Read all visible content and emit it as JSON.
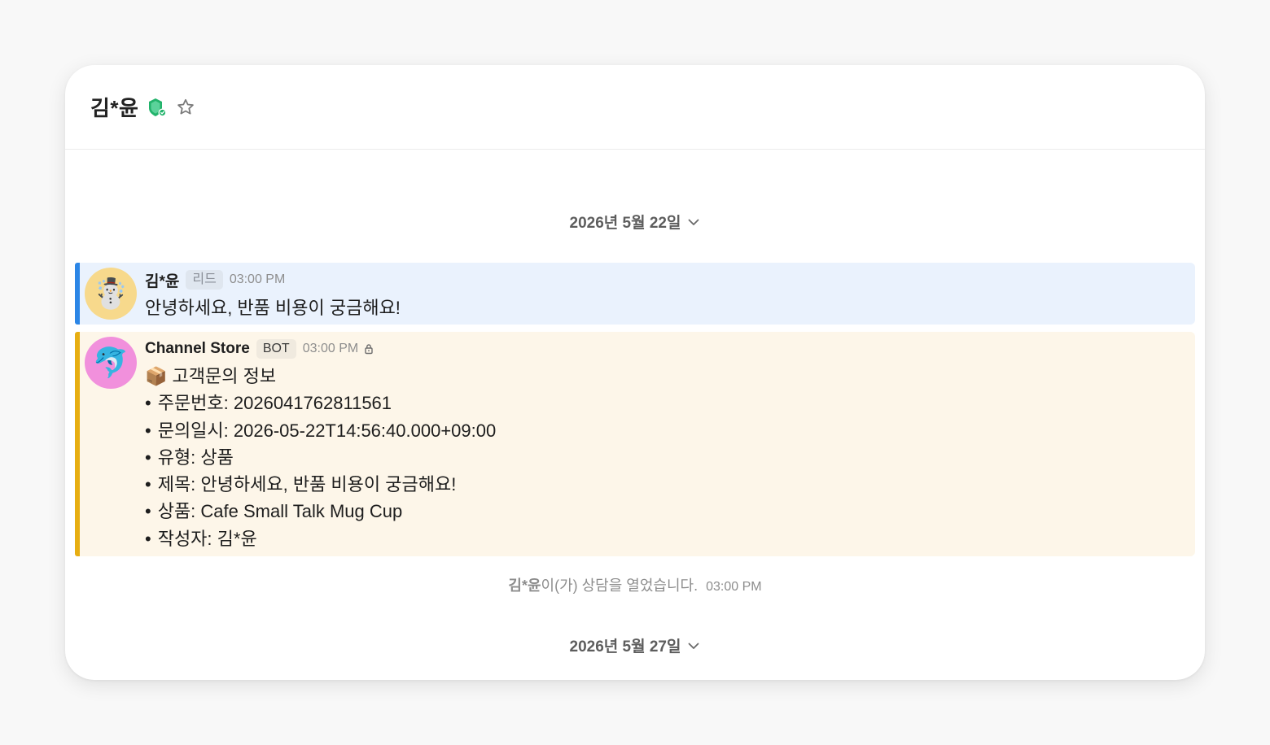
{
  "header": {
    "title": "김*윤",
    "badge_icon": "shield-badge-icon",
    "star_icon": "star-outline-icon"
  },
  "dividers": [
    {
      "label": "2026년 5월 22일"
    },
    {
      "label": "2026년 5월 27일"
    }
  ],
  "messages": {
    "user": {
      "avatar": "☃️",
      "sender": "김*윤",
      "tag": "리드",
      "time": "03:00 PM",
      "text": "안녕하세요, 반품 비용이 궁금해요!"
    },
    "bot": {
      "avatar": "🐬",
      "sender": "Channel Store",
      "tag": "BOT",
      "time": "03:00 PM",
      "lines": [
        "📦 고객문의 정보",
        "주문번호: 2026041762811561",
        "문의일시: 2026-05-22T14:56:40.000+09:00",
        "유형: 상품",
        "제목: 안녕하세요, 반품 비용이 궁금해요!",
        "상품: Cafe Small Talk Mug Cup",
        "작성자: 김*윤"
      ]
    }
  },
  "system_note": {
    "actor": "김*윤",
    "text": "이(가) 상담을 열었습니다.",
    "time": "03:00 PM"
  },
  "colors": {
    "user_bar": "#2c86e6",
    "user_bg": "#eaf2fd",
    "bot_bar": "#e7ae12",
    "bot_bg": "#fdf6e9",
    "badge_green": "#22b36b"
  }
}
